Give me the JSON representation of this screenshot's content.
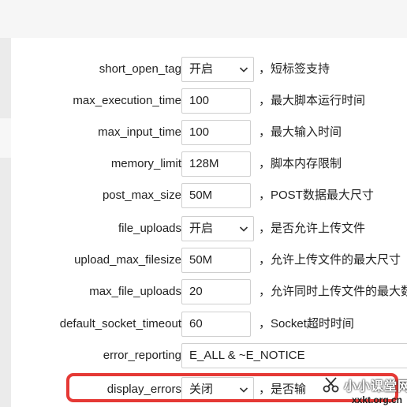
{
  "settings": {
    "rows": [
      {
        "label": "short_open_tag",
        "type": "select",
        "value": "开启",
        "hint": "，短标签支持"
      },
      {
        "label": "max_execution_time",
        "type": "input",
        "value": "100",
        "hint": "，最大脚本运行时间"
      },
      {
        "label": "max_input_time",
        "type": "input",
        "value": "100",
        "hint": "，最大输入时间"
      },
      {
        "label": "memory_limit",
        "type": "input",
        "value": "128M",
        "hint": "，脚本内存限制"
      },
      {
        "label": "post_max_size",
        "type": "input",
        "value": "50M",
        "hint": "，POST数据最大尺寸"
      },
      {
        "label": "file_uploads",
        "type": "select",
        "value": "开启",
        "hint": "，是否允许上传文件"
      },
      {
        "label": "upload_max_filesize",
        "type": "input",
        "value": "50M",
        "hint": "，允许上传文件的最大尺寸"
      },
      {
        "label": "max_file_uploads",
        "type": "input",
        "value": "20",
        "hint": "，允许同时上传文件的最大数"
      },
      {
        "label": "default_socket_timeout",
        "type": "input",
        "value": "60",
        "hint": "，Socket超时时间"
      },
      {
        "label": "error_reporting",
        "type": "input-wide",
        "value": "E_ALL & ~E_NOTICE",
        "hint": ""
      },
      {
        "label": "display_errors",
        "type": "select",
        "value": "关闭",
        "hint": "，是否输"
      }
    ]
  },
  "watermark": {
    "name": "小小课堂网",
    "domain": "xxkt.org.cn"
  },
  "icons": {
    "select_arrow": "chevron-down-icon",
    "logo": "scissors-icon"
  },
  "colors": {
    "highlight": "#e53935",
    "border": "#cfcfcf",
    "text": "#222222"
  }
}
